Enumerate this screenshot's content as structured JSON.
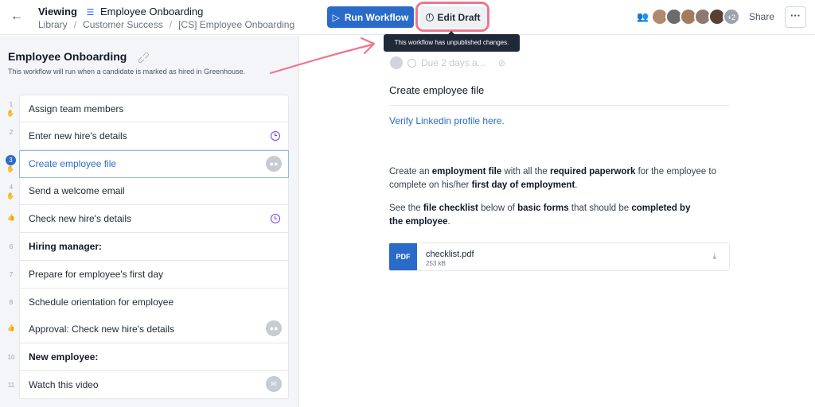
{
  "header": {
    "viewing_label": "Viewing",
    "workflow_name": "Employee Onboarding",
    "breadcrumb": [
      "Library",
      "Customer Success",
      "[CS] Employee Onboarding"
    ],
    "run_label": "Run Workflow",
    "edit_label": "Edit Draft",
    "avatar_more": "+2",
    "share_label": "Share",
    "more_label": "···"
  },
  "tooltip": "This workflow has unpublished changes.",
  "sidebar": {
    "title": "Employee Onboarding",
    "description": "This workflow will run when a candidate is marked as hired in Greenhouse.",
    "steps": [
      {
        "num": "1",
        "label": "Assign team members"
      },
      {
        "num": "2",
        "label": "Enter new hire's details"
      },
      {
        "num": "3",
        "label": "Create employee file"
      },
      {
        "num": "4",
        "label": "Send a welcome email"
      },
      {
        "num": "",
        "label": "Check new hire's details"
      },
      {
        "num": "6",
        "label": "Hiring manager:"
      },
      {
        "num": "7",
        "label": "Prepare for employee's first day"
      },
      {
        "num": "8",
        "label": "Schedule orientation for employee"
      },
      {
        "num": "",
        "label": "Approval: Check new hire's details"
      },
      {
        "num": "10",
        "label": "New employee:"
      },
      {
        "num": "11",
        "label": "Watch this video"
      }
    ]
  },
  "main": {
    "due_label": "Due 2 days a...",
    "step_title": "Create employee file",
    "link_text": "Verify Linkedin profile here.",
    "p1": {
      "t1": "Create an ",
      "b1": "employment file",
      "t2": " with all the ",
      "b2": "required paperwork",
      "t3": " for the employee to complete on his/her ",
      "b3": "first day of employment",
      "t4": "."
    },
    "p2": {
      "t1": "See the ",
      "b1": "file checklist",
      "t2": " below of ",
      "b2": "basic forms",
      "t3": " that should be ",
      "b3": "completed by the employee",
      "t4": "."
    },
    "file": {
      "badge": "PDF",
      "name": "checklist.pdf",
      "size": "253 kB"
    }
  },
  "colors": {
    "accent": "#2a6bc9",
    "highlight": "#f0758c",
    "clock": "#7c3aed",
    "sidebar_bg": "#f3f5f8"
  }
}
